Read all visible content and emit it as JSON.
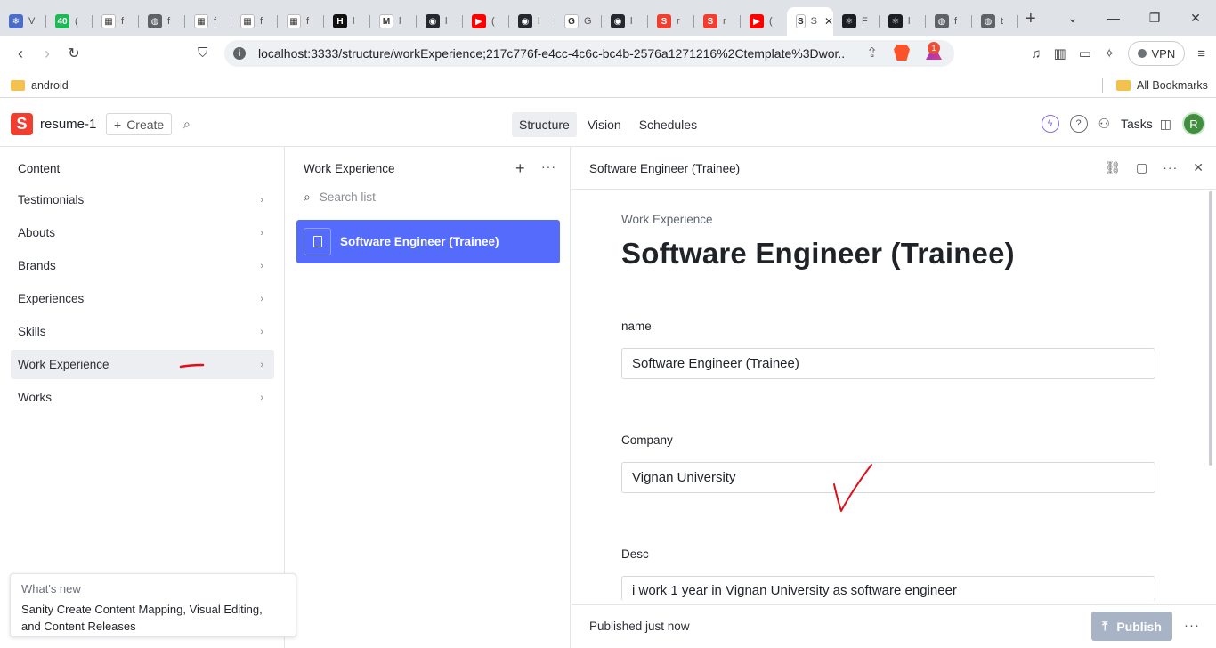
{
  "browser": {
    "tabs": [
      {
        "label": "V",
        "color": "#4b6cc9",
        "glyph": "❄"
      },
      {
        "label": "(",
        "color": "#1db954",
        "glyph": "40"
      },
      {
        "label": "f",
        "color": "#ffffff",
        "glyph": "▦"
      },
      {
        "label": "f",
        "color": "#5f6368",
        "glyph": "◍"
      },
      {
        "label": "f",
        "color": "#ffffff",
        "glyph": "▦"
      },
      {
        "label": "f",
        "color": "#ffffff",
        "glyph": "▦"
      },
      {
        "label": "f",
        "color": "#ffffff",
        "glyph": "▦"
      },
      {
        "label": "l",
        "color": "#111111",
        "glyph": "H"
      },
      {
        "label": "l",
        "color": "#ffffff",
        "glyph": "M"
      },
      {
        "label": "l",
        "color": "#24292f",
        "glyph": "◉"
      },
      {
        "label": "(",
        "color": "#ff0000",
        "glyph": "▶"
      },
      {
        "label": "l",
        "color": "#24292f",
        "glyph": "◉"
      },
      {
        "label": "G",
        "color": "#ffffff",
        "glyph": "G"
      },
      {
        "label": "l",
        "color": "#24292f",
        "glyph": "◉"
      },
      {
        "label": "r",
        "color": "#f03e2f",
        "glyph": "S"
      },
      {
        "label": "r",
        "color": "#f03e2f",
        "glyph": "S"
      },
      {
        "label": "(",
        "color": "#ff0000",
        "glyph": "▶"
      },
      {
        "label": "S",
        "color": "#ffffff",
        "glyph": "S"
      },
      {
        "label": "F",
        "color": "#1b1f24",
        "glyph": "⚛"
      },
      {
        "label": "l",
        "color": "#1b1f24",
        "glyph": "⚛"
      },
      {
        "label": "f",
        "color": "#5f6368",
        "glyph": "◍"
      },
      {
        "label": "t",
        "color": "#5f6368",
        "glyph": "◍"
      }
    ],
    "url": "localhost:3333/structure/workExperience;217c776f-e4cc-4c6c-bc4b-2576a1271216%2Ctemplate%3Dwor...",
    "rewards_badge": "1",
    "vpn_label": "VPN",
    "bookmark_folder": "android",
    "all_bookmarks": "All Bookmarks"
  },
  "app": {
    "logo_letter": "S",
    "project_name": "resume-1",
    "create_label": "Create",
    "nav_tabs": [
      "Structure",
      "Vision",
      "Schedules"
    ],
    "active_tab": "Structure",
    "tasks_label": "Tasks",
    "avatar_initial": "R"
  },
  "content_pane": {
    "title": "Content",
    "items": [
      {
        "label": "Testimonials"
      },
      {
        "label": "Abouts"
      },
      {
        "label": "Brands"
      },
      {
        "label": "Experiences"
      },
      {
        "label": "Skills"
      },
      {
        "label": "Work Experience"
      },
      {
        "label": "Works"
      }
    ],
    "selected_index": 5
  },
  "list_pane": {
    "title": "Work Experience",
    "search_placeholder": "Search list",
    "documents": [
      {
        "title": "Software Engineer (Trainee)"
      }
    ]
  },
  "document": {
    "header_title": "Software Engineer (Trainee)",
    "type_label": "Work Experience",
    "title": "Software Engineer (Trainee)",
    "fields": [
      {
        "label": "name",
        "value": "Software Engineer (Trainee)"
      },
      {
        "label": "Company",
        "value": "Vignan University"
      },
      {
        "label": "Desc",
        "value": "i work 1 year in Vignan University as software engineer"
      }
    ],
    "status": "Published just now",
    "publish_label": "Publish"
  },
  "whats_new": {
    "title": "What's new",
    "body": "Sanity Create Content Mapping, Visual Editing, and Content Releases"
  },
  "colors": {
    "accent": "#556bfb",
    "sanity_red": "#f03e2f",
    "publish_disabled": "#a8b3c6",
    "annotation_red": "#e0101a"
  }
}
